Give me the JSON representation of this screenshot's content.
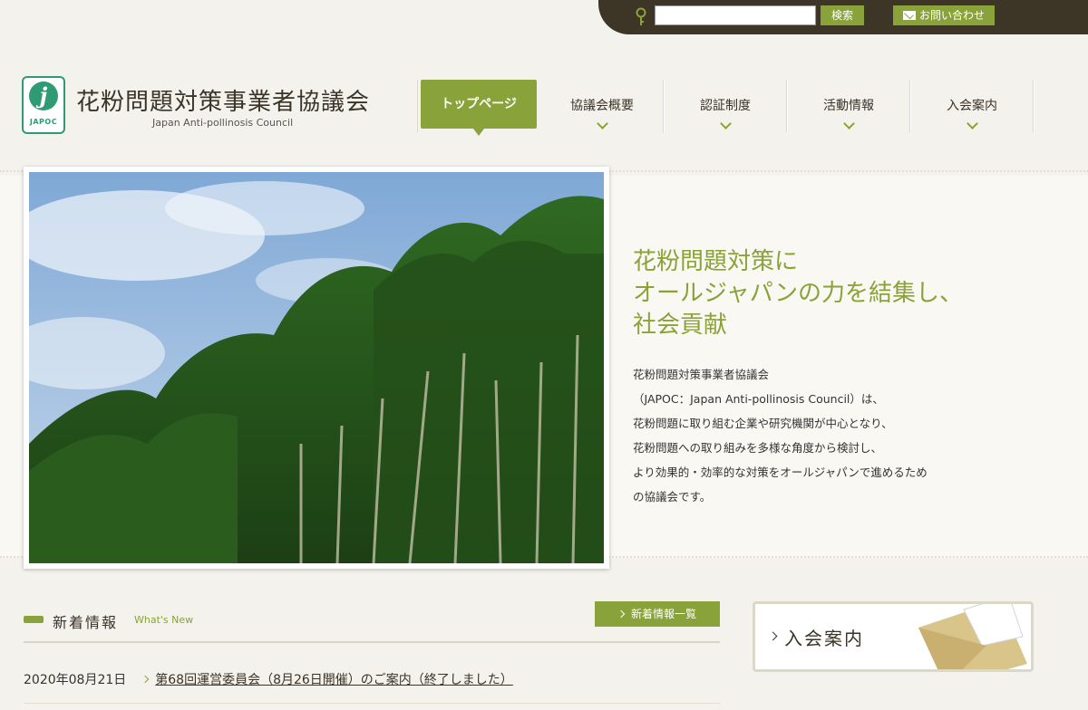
{
  "topbar": {
    "search_placeholder": "",
    "search_button": "検索",
    "contact_button": "お問い合わせ"
  },
  "header": {
    "logo_text": "JAPOC",
    "org_name": "花粉問題対策事業者協議会",
    "org_name_en": "Japan Anti-pollinosis Council"
  },
  "nav": {
    "items": [
      {
        "label": "トップページ",
        "active": true
      },
      {
        "label": "協議会概要"
      },
      {
        "label": "認証制度"
      },
      {
        "label": "活動情報"
      },
      {
        "label": "入会案内"
      }
    ]
  },
  "hero": {
    "catch_lines": [
      "花粉問題対策に",
      "オールジャパンの力を結集し、",
      "社会貢献"
    ],
    "intro_lines": [
      "花粉問題対策事業者協議会",
      "（JAPOC：Japan Anti-pollinosis Council）は、",
      "花粉問題に取り組む企業や研究機関が中心となり、",
      "花粉問題への取り組みを多様な角度から検討し、",
      "より効果的・効率的な対策をオールジャパンで進めるため",
      "の協議会です。"
    ]
  },
  "news": {
    "title": "新着情報",
    "subtitle": "What's New",
    "all_button": "新着情報一覧",
    "items": [
      {
        "date": "2020年08月21日",
        "title": "第68回運営委員会（8月26日開催）のご案内（終了しました）"
      }
    ]
  },
  "side": {
    "join_banner": "入会案内"
  },
  "colors": {
    "accent_green": "#8aa23a",
    "logo_green": "#2e9b74",
    "topbar_dark": "#3d3526"
  }
}
